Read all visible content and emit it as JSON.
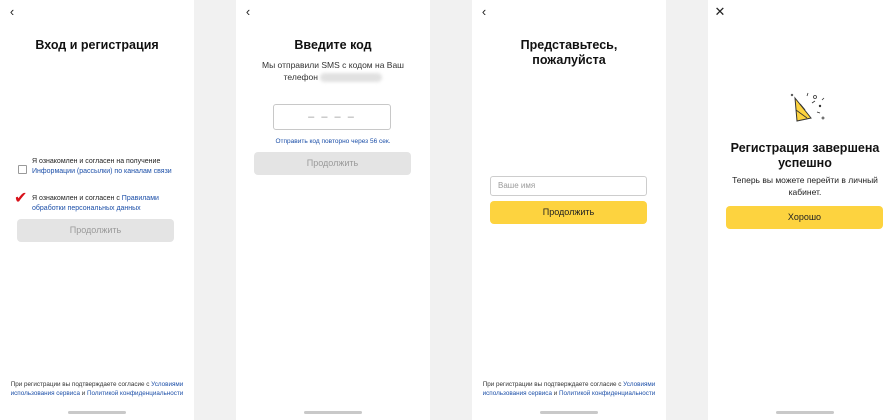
{
  "screen1": {
    "nav_icon": "chevron-left-icon",
    "nav_glyph": "‹",
    "title": "Вход и регистрация",
    "consent1_text": "Я ознакомлен и согласен на получение ",
    "consent1_link": "Информации (рассылки) по каналам связи",
    "consent1_checked": false,
    "consent2_text": "Я ознакомлен и согласен с ",
    "consent2_link": "Правилами обработки персональных данных",
    "consent2_checked": true,
    "check_glyph": "✔",
    "continue_label": "Продолжить",
    "footer_text": "При регистрации вы подтверждаете согласие с ",
    "footer_link1": "Условиями использования сервиса",
    "footer_and": " и ",
    "footer_link2": "Политикой конфиденциальности"
  },
  "screen2": {
    "nav_icon": "chevron-left-icon",
    "nav_glyph": "‹",
    "title": "Введите код",
    "subtitle_line1": "Мы отправили SMS с кодом на Ваш",
    "subtitle_line2": "телефон",
    "code_placeholder": "– – – –",
    "resend_text": "Отправить код повторно через 56 сек.",
    "continue_label": "Продолжить"
  },
  "screen3": {
    "nav_icon": "chevron-left-icon",
    "nav_glyph": "‹",
    "title": "Представьтесь, пожалуйста",
    "name_placeholder": "Ваше имя",
    "continue_label": "Продолжить",
    "footer_text": "При регистрации вы подтверждаете согласие с ",
    "footer_link1": "Условиями использования сервиса",
    "footer_and": " и ",
    "footer_link2": "Политикой конфиденциальности"
  },
  "screen4": {
    "nav_icon": "close-icon",
    "nav_glyph": "✕",
    "success_icon": "party-popper-icon",
    "title": "Регистрация завершена успешно",
    "text": "Теперь вы можете перейти в личный кабинет.",
    "ok_label": "Хорошо"
  },
  "colors": {
    "accent_yellow": "#fdd33f",
    "link_blue": "#1c4fa8",
    "check_red": "#d8121b",
    "disabled_gray": "#e4e4e4"
  }
}
